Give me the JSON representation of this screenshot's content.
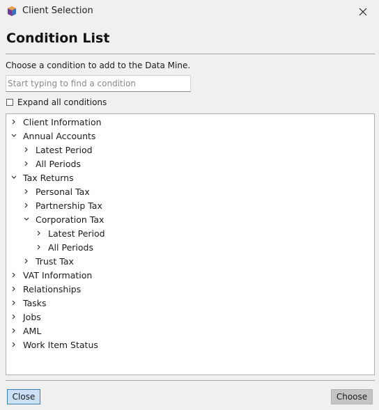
{
  "window": {
    "title": "Client Selection",
    "app_icon": "app-logo-icon",
    "close_icon": "close-icon"
  },
  "heading": "Condition List",
  "instruction": "Choose a condition to add to the Data Mine.",
  "search": {
    "value": "",
    "placeholder": "Start typing to find a condition"
  },
  "expand_all": {
    "label": "Expand all conditions",
    "checked": false
  },
  "tree": [
    {
      "label": "Client Information",
      "level": 0,
      "expanded": false
    },
    {
      "label": "Annual Accounts",
      "level": 0,
      "expanded": true
    },
    {
      "label": "Latest Period",
      "level": 1,
      "expanded": false
    },
    {
      "label": "All Periods",
      "level": 1,
      "expanded": false
    },
    {
      "label": "Tax Returns",
      "level": 0,
      "expanded": true
    },
    {
      "label": "Personal Tax",
      "level": 1,
      "expanded": false
    },
    {
      "label": "Partnership Tax",
      "level": 1,
      "expanded": false
    },
    {
      "label": "Corporation Tax",
      "level": 1,
      "expanded": true
    },
    {
      "label": "Latest Period",
      "level": 2,
      "expanded": false
    },
    {
      "label": "All Periods",
      "level": 2,
      "expanded": false
    },
    {
      "label": "Trust Tax",
      "level": 1,
      "expanded": false
    },
    {
      "label": "VAT Information",
      "level": 0,
      "expanded": false
    },
    {
      "label": "Relationships",
      "level": 0,
      "expanded": false
    },
    {
      "label": "Tasks",
      "level": 0,
      "expanded": false
    },
    {
      "label": "Jobs",
      "level": 0,
      "expanded": false
    },
    {
      "label": "AML",
      "level": 0,
      "expanded": false
    },
    {
      "label": "Work Item Status",
      "level": 0,
      "expanded": false
    }
  ],
  "buttons": {
    "close": "Close",
    "choose": "Choose"
  },
  "colors": {
    "close_button_bg": "#cce0f5",
    "close_button_border": "#3c7fb1",
    "choose_button_bg": "#c4c4c4"
  }
}
